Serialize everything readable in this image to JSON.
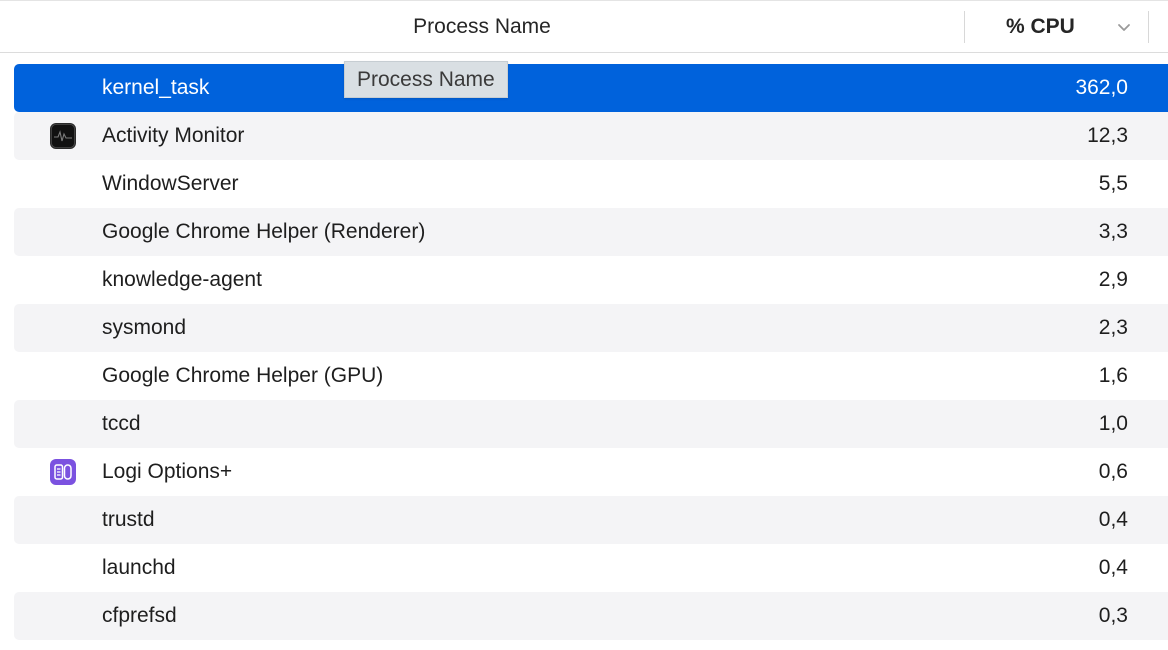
{
  "header": {
    "name_label": "Process Name",
    "cpu_label": "% CPU",
    "sort_icon": "chevron-down-icon"
  },
  "tooltip": "Process Name",
  "processes": [
    {
      "name": "kernel_task",
      "cpu": "362,0",
      "selected": true
    },
    {
      "name": "Activity Monitor",
      "cpu": "12,3",
      "icon": "activity-monitor-icon"
    },
    {
      "name": "WindowServer",
      "cpu": "5,5"
    },
    {
      "name": "Google Chrome Helper (Renderer)",
      "cpu": "3,3"
    },
    {
      "name": "knowledge-agent",
      "cpu": "2,9"
    },
    {
      "name": "sysmond",
      "cpu": "2,3"
    },
    {
      "name": "Google Chrome Helper (GPU)",
      "cpu": "1,6"
    },
    {
      "name": "tccd",
      "cpu": "1,0"
    },
    {
      "name": "Logi Options+",
      "cpu": "0,6",
      "icon": "logi-options-icon"
    },
    {
      "name": "trustd",
      "cpu": "0,4"
    },
    {
      "name": "launchd",
      "cpu": "0,4"
    },
    {
      "name": "cfprefsd",
      "cpu": "0,3"
    }
  ],
  "colors": {
    "selection": "#0062dc",
    "alt_row": "#f4f4f6",
    "logi_purple": "#7b52e0"
  }
}
